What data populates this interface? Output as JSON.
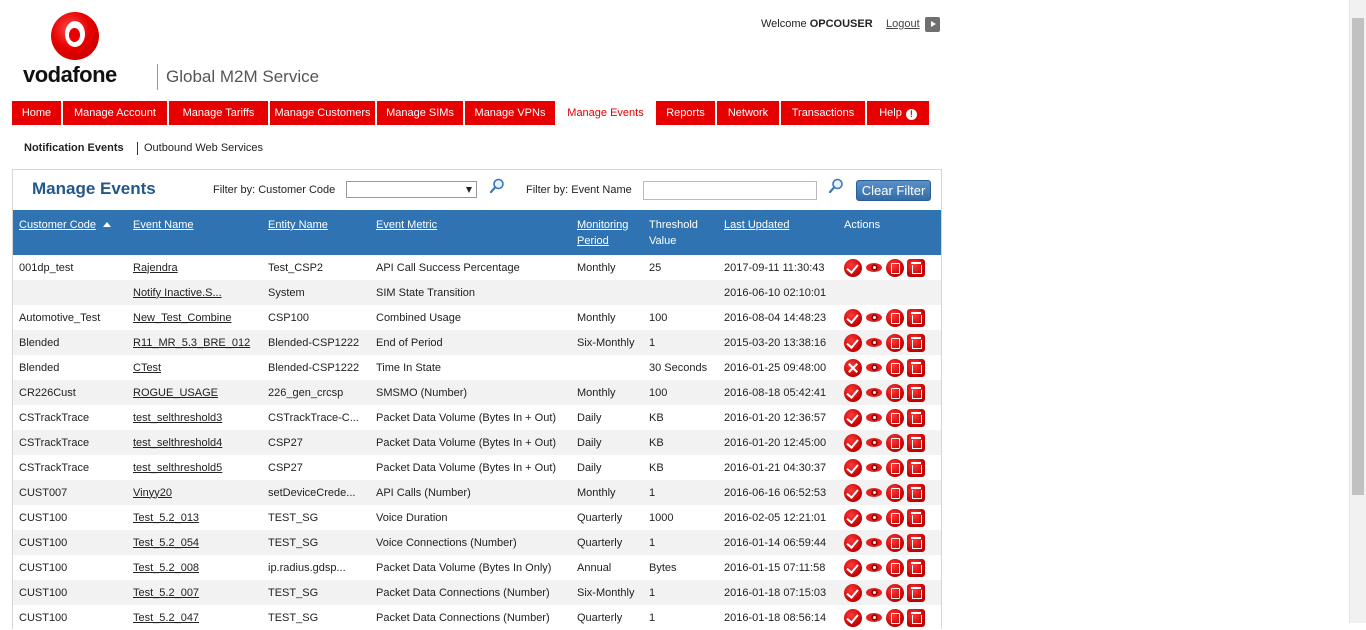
{
  "header": {
    "brand": "vodafone",
    "service": "Global M2M Service",
    "welcome_prefix": "Welcome",
    "user": "OPCOUSER",
    "logout": "Logout"
  },
  "nav": {
    "items": [
      {
        "label": "Home"
      },
      {
        "label": "Manage Account"
      },
      {
        "label": "Manage Tariffs"
      },
      {
        "label": "Manage Customers"
      },
      {
        "label": "Manage SIMs"
      },
      {
        "label": "Manage VPNs"
      },
      {
        "label": "Manage Events"
      },
      {
        "label": "Reports"
      },
      {
        "label": "Network"
      },
      {
        "label": "Transactions"
      },
      {
        "label": "Help"
      }
    ],
    "active": "Manage Events"
  },
  "subnav": {
    "items": [
      "Notification Events",
      "Outbound Web Services"
    ]
  },
  "panel": {
    "title": "Manage Events",
    "filter_customer_label": "Filter by: Customer Code",
    "filter_customer_value": "",
    "filter_event_label": "Filter by: Event Name",
    "filter_event_value": "",
    "clear_filter": "Clear Filter"
  },
  "table": {
    "columns": [
      {
        "label": "Customer Code",
        "sortable": true
      },
      {
        "label": "Event Name",
        "sortable": true
      },
      {
        "label": "Entity Name",
        "sortable": true
      },
      {
        "label": "Event Metric",
        "sortable": true
      },
      {
        "label": "Monitoring Period",
        "sortable": true
      },
      {
        "label": "Threshold Value",
        "sortable": false
      },
      {
        "label": "Last Updated",
        "sortable": true
      },
      {
        "label": "Actions",
        "sortable": false
      }
    ],
    "rows": [
      {
        "customer": "001dp_test",
        "event": "Rajendra",
        "entity": "Test_CSP2",
        "metric": "API Call Success Percentage",
        "period": "Monthly",
        "threshold": "25",
        "updated": "2017-09-11 11:30:43",
        "status": "check",
        "actions": true
      },
      {
        "customer": "",
        "event": "Notify Inactive.S...",
        "entity": "System",
        "metric": "SIM State Transition",
        "period": "",
        "threshold": "",
        "updated": "2016-06-10 02:10:01",
        "status": "",
        "actions": false
      },
      {
        "customer": "Automotive_Test",
        "event": "New_Test_Combine",
        "entity": "CSP100",
        "metric": "Combined Usage",
        "period": "Monthly",
        "threshold": "100",
        "updated": "2016-08-04 14:48:23",
        "status": "check",
        "actions": true
      },
      {
        "customer": "Blended",
        "event": "R11_MR_5.3_BRE_012",
        "entity": "Blended-CSP1222",
        "metric": "End of Period",
        "period": "Six-Monthly",
        "threshold": "1",
        "updated": "2015-03-20 13:38:16",
        "status": "check",
        "actions": true
      },
      {
        "customer": "Blended",
        "event": "CTest",
        "entity": "Blended-CSP1222",
        "metric": "Time In State",
        "period": "",
        "threshold": "30 Seconds",
        "updated": "2016-01-25 09:48:00",
        "status": "cross",
        "actions": true
      },
      {
        "customer": "CR226Cust",
        "event": "ROGUE_USAGE",
        "entity": "226_gen_crcsp",
        "metric": "SMSMO (Number)",
        "period": "Monthly",
        "threshold": "100",
        "updated": "2016-08-18 05:42:41",
        "status": "check",
        "actions": true
      },
      {
        "customer": "CSTrackTrace",
        "event": "test_selthreshold3",
        "entity": "CSTrackTrace-C...",
        "metric": "Packet Data Volume (Bytes In + Out)",
        "period": "Daily",
        "threshold": " KB",
        "updated": "2016-01-20 12:36:57",
        "status": "check",
        "actions": true
      },
      {
        "customer": "CSTrackTrace",
        "event": "test_selthreshold4",
        "entity": "CSP27",
        "metric": "Packet Data Volume (Bytes In + Out)",
        "period": "Daily",
        "threshold": " KB",
        "updated": "2016-01-20 12:45:00",
        "status": "check",
        "actions": true
      },
      {
        "customer": "CSTrackTrace",
        "event": "test_selthreshold5",
        "entity": "CSP27",
        "metric": "Packet Data Volume (Bytes In + Out)",
        "period": "Daily",
        "threshold": " KB",
        "updated": "2016-01-21 04:30:37",
        "status": "check",
        "actions": true
      },
      {
        "customer": "CUST007",
        "event": "Vinyy20",
        "entity": "setDeviceCrede...",
        "metric": "API Calls (Number)",
        "period": "Monthly",
        "threshold": "1",
        "updated": "2016-06-16 06:52:53",
        "status": "check",
        "actions": true
      },
      {
        "customer": "CUST100",
        "event": "Test_5.2_013",
        "entity": "TEST_SG",
        "metric": "Voice Duration",
        "period": "Quarterly",
        "threshold": "1000",
        "updated": "2016-02-05 12:21:01",
        "status": "check",
        "actions": true
      },
      {
        "customer": "CUST100",
        "event": "Test_5.2_054",
        "entity": "TEST_SG",
        "metric": "Voice Connections (Number)",
        "period": "Quarterly",
        "threshold": "1",
        "updated": "2016-01-14 06:59:44",
        "status": "check",
        "actions": true
      },
      {
        "customer": "CUST100",
        "event": "Test_5.2_008",
        "entity": "ip.radius.gdsp...",
        "metric": "Packet Data Volume (Bytes In Only)",
        "period": "Annual",
        "threshold": " Bytes",
        "updated": "2016-01-15 07:11:58",
        "status": "check",
        "actions": true
      },
      {
        "customer": "CUST100",
        "event": "Test_5.2_007",
        "entity": "TEST_SG",
        "metric": "Packet Data Connections (Number)",
        "period": "Six-Monthly",
        "threshold": "1",
        "updated": "2016-01-18 07:15:03",
        "status": "check",
        "actions": true
      },
      {
        "customer": "CUST100",
        "event": "Test_5.2_047",
        "entity": "TEST_SG",
        "metric": "Packet Data Connections (Number)",
        "period": "Quarterly",
        "threshold": "1",
        "updated": "2016-01-18 08:56:14",
        "status": "check",
        "actions": true
      }
    ]
  },
  "icons": {
    "status_enabled": "check-circle-icon",
    "status_disabled": "cross-circle-icon",
    "view": "eye-icon",
    "edit": "edit-icon",
    "delete": "trash-icon",
    "search": "search-icon"
  },
  "colors": {
    "brand_red": "#e60000",
    "table_header": "#2f73b3",
    "title_blue": "#24578a"
  }
}
